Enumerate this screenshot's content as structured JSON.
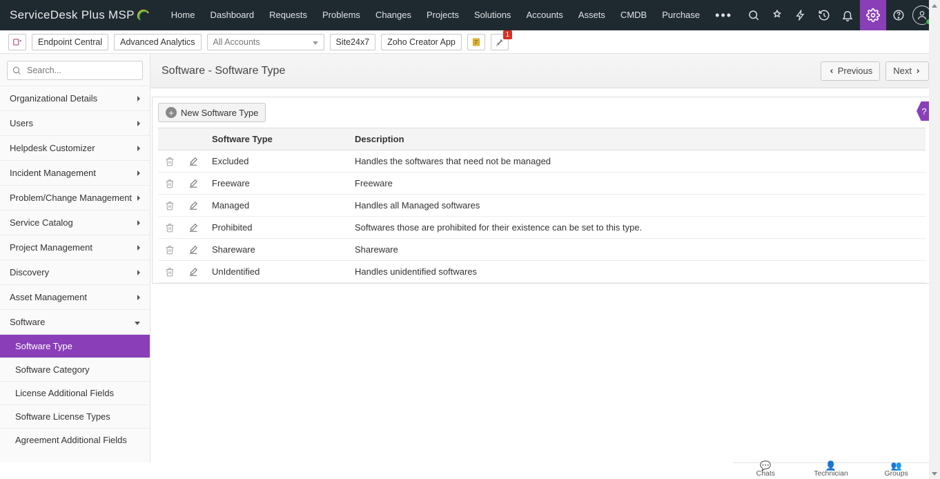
{
  "brand": {
    "line1": "ServiceDesk",
    "line2": "Plus MSP"
  },
  "nav": [
    "Home",
    "Dashboard",
    "Requests",
    "Problems",
    "Changes",
    "Projects",
    "Solutions",
    "Accounts",
    "Assets",
    "CMDB",
    "Purchase"
  ],
  "secbar": {
    "endpoint": "Endpoint Central",
    "analytics": "Advanced Analytics",
    "accounts_placeholder": "All Accounts",
    "site247": "Site24x7",
    "zoho": "Zoho Creator App",
    "pin_badge": "1"
  },
  "search_placeholder": "Search...",
  "sidebar": {
    "sections": [
      {
        "label": "Organizational Details"
      },
      {
        "label": "Users"
      },
      {
        "label": "Helpdesk Customizer"
      },
      {
        "label": "Incident Management"
      },
      {
        "label": "Problem/Change Management"
      },
      {
        "label": "Service Catalog"
      },
      {
        "label": "Project Management"
      },
      {
        "label": "Discovery"
      },
      {
        "label": "Asset Management"
      },
      {
        "label": "Software",
        "expanded": true,
        "children": [
          {
            "label": "Software Type",
            "active": true
          },
          {
            "label": "Software Category"
          },
          {
            "label": "License Additional Fields"
          },
          {
            "label": "Software License Types"
          },
          {
            "label": "Agreement Additional Fields"
          }
        ]
      }
    ]
  },
  "page": {
    "title": "Software - Software Type",
    "prev": "Previous",
    "next": "Next",
    "newbtn": "New Software Type"
  },
  "table": {
    "headers": {
      "type": "Software Type",
      "desc": "Description"
    },
    "rows": [
      {
        "type": "Excluded",
        "desc": "Handles the softwares that need not be managed"
      },
      {
        "type": "Freeware",
        "desc": "Freeware"
      },
      {
        "type": "Managed",
        "desc": "Handles all Managed softwares"
      },
      {
        "type": "Prohibited",
        "desc": "Softwares those are prohibited for their existence can be set to this type."
      },
      {
        "type": "Shareware",
        "desc": "Shareware"
      },
      {
        "type": "UnIdentified",
        "desc": "Handles unidentified softwares"
      }
    ]
  },
  "footer": {
    "chats": "Chats",
    "technician": "Technician",
    "groups": "Groups"
  }
}
